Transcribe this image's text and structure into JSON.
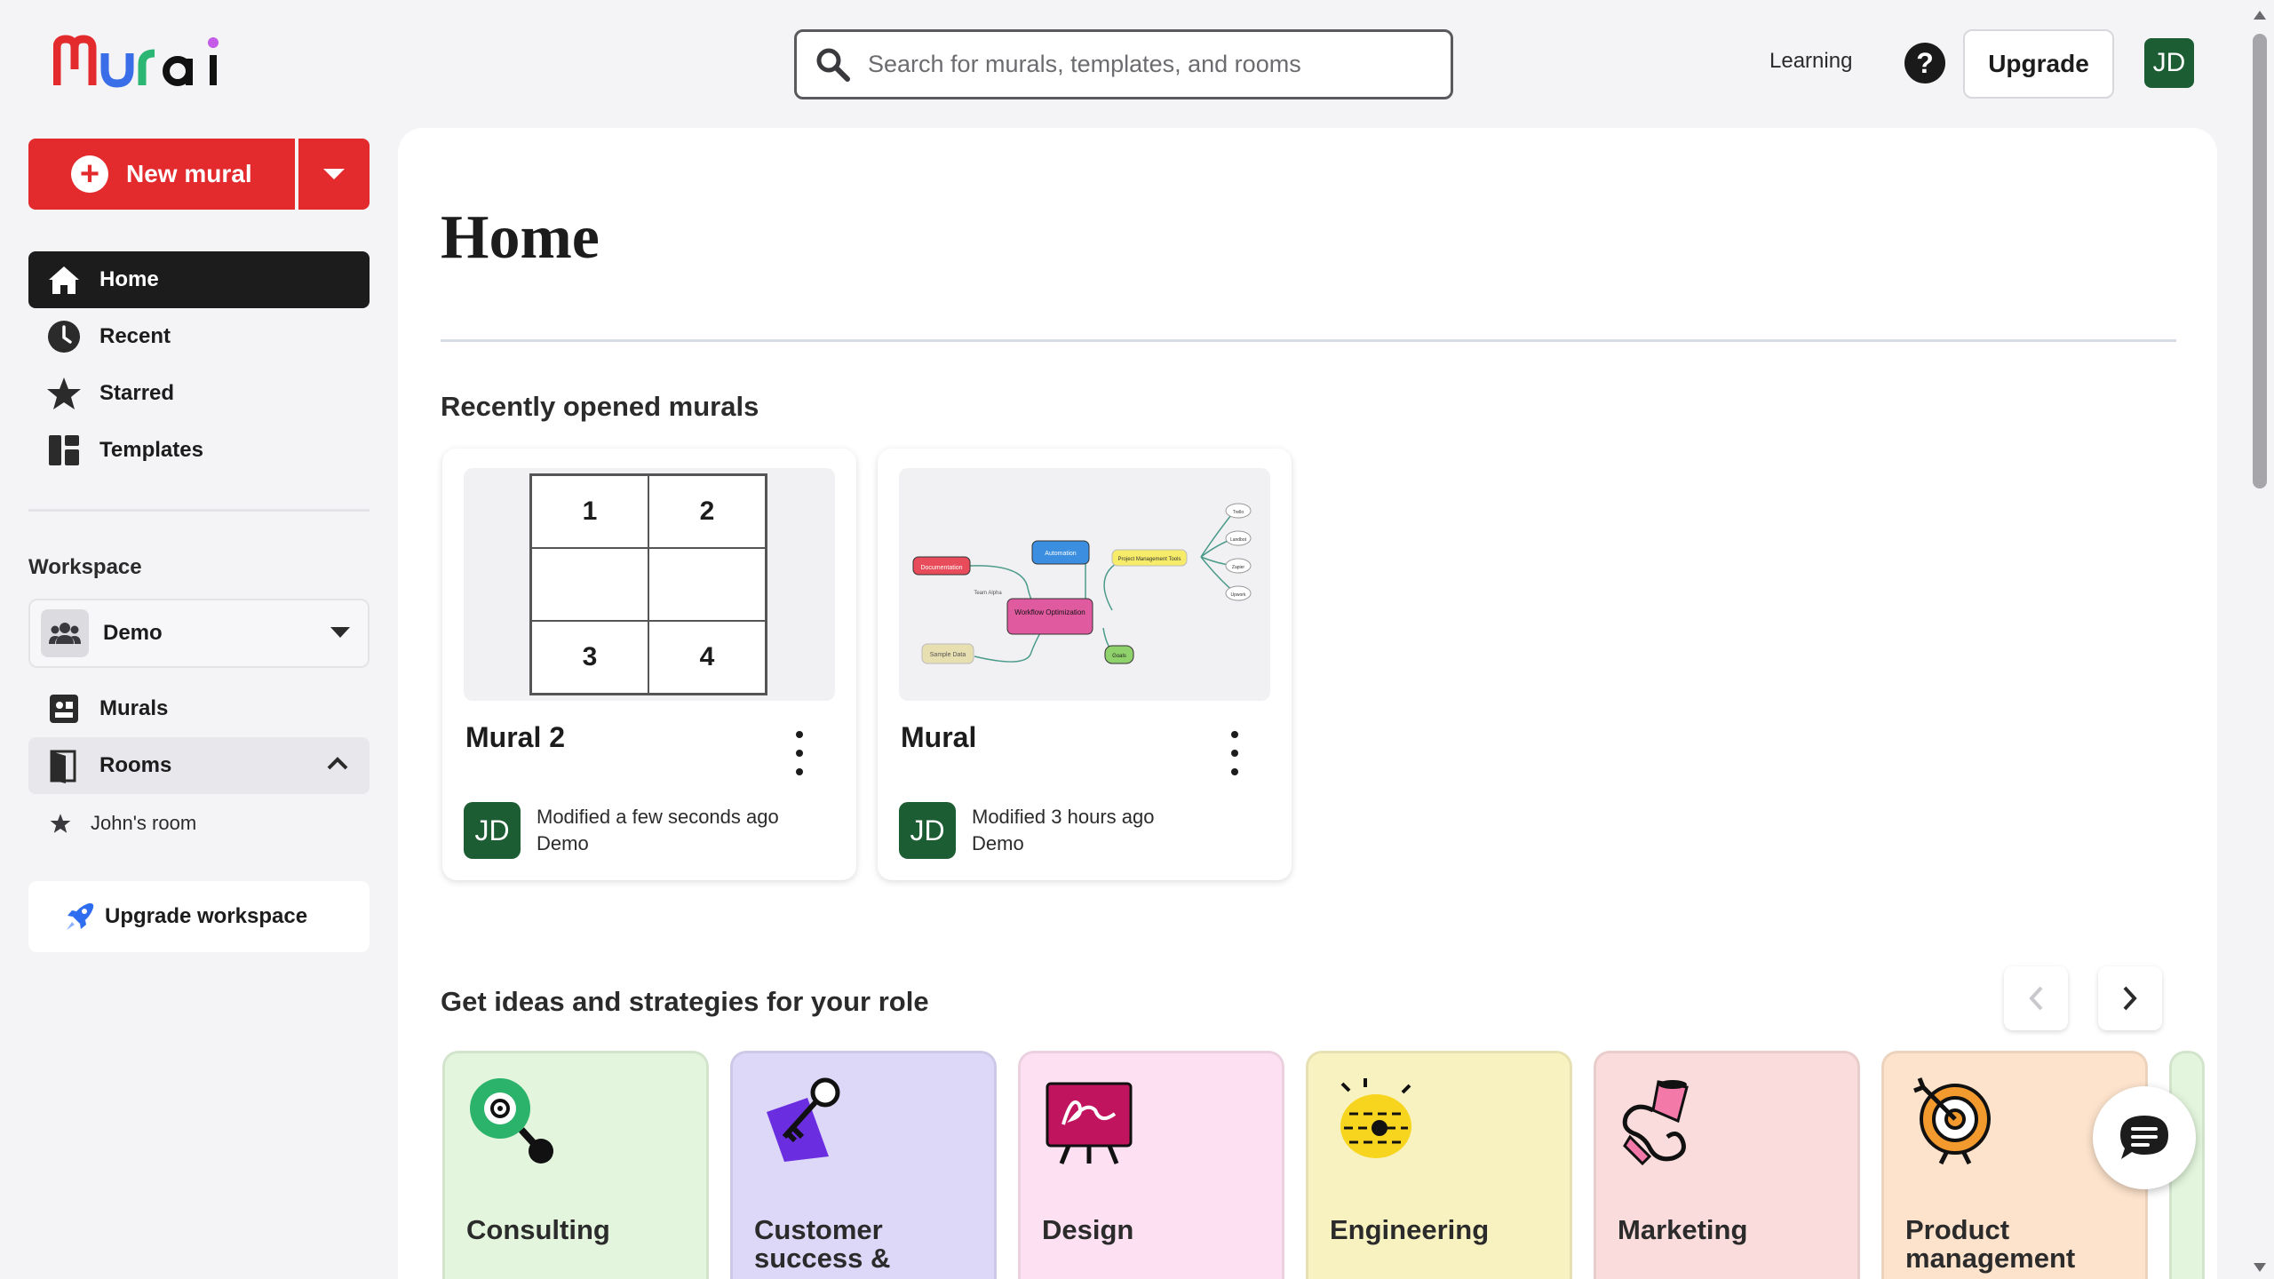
{
  "header": {
    "logo_text": "Mural",
    "search_placeholder": "Search for murals, templates, and rooms",
    "learning_label": "Learning",
    "help_label": "?",
    "upgrade_label": "Upgrade",
    "user_initials": "JD"
  },
  "sidebar": {
    "new_mural_label": "New mural",
    "nav": [
      {
        "label": "Home",
        "icon": "home-icon",
        "active": true
      },
      {
        "label": "Recent",
        "icon": "clock-icon"
      },
      {
        "label": "Starred",
        "icon": "star-icon"
      },
      {
        "label": "Templates",
        "icon": "templates-icon"
      }
    ],
    "workspace_label": "Workspace",
    "workspace_name": "Demo",
    "workspace_nav": [
      {
        "label": "Murals",
        "icon": "murals-icon"
      },
      {
        "label": "Rooms",
        "icon": "rooms-icon",
        "expanded": true
      }
    ],
    "rooms": [
      {
        "label": "John's room",
        "icon": "star-icon"
      }
    ],
    "upgrade_workspace_label": "Upgrade workspace"
  },
  "main": {
    "title": "Home",
    "recent_title": "Recently opened murals",
    "murals": [
      {
        "title": "Mural 2",
        "modified": "Modified a few seconds ago",
        "workspace": "Demo",
        "initials": "JD",
        "thumb_cells": [
          "1",
          "2",
          "",
          "",
          "3",
          "4"
        ]
      },
      {
        "title": "Mural",
        "modified": "Modified 3 hours ago",
        "workspace": "Demo",
        "initials": "JD",
        "thumb_nodes": {
          "center": "Workflow Optimization",
          "a": "Automation",
          "b": "Project Management Tools",
          "c": "Documentation",
          "d": "Sample Data",
          "e": "Goals",
          "f": "Team Alpha",
          "g": "Trello",
          "h": "Landbot",
          "i": "Zapier",
          "j": "Upwork"
        }
      }
    ],
    "ideas_title": "Get ideas and strategies for your role",
    "roles": [
      {
        "label": "Consulting",
        "color": "#e3f6dd"
      },
      {
        "label": "Customer success &",
        "color": "#ddd8f8"
      },
      {
        "label": "Design",
        "color": "#fde0f2"
      },
      {
        "label": "Engineering",
        "color": "#f8f2c0"
      },
      {
        "label": "Marketing",
        "color": "#fbdcdc"
      },
      {
        "label": "Product management",
        "color": "#fde3cc"
      }
    ]
  },
  "colors": {
    "brand_red": "#e32b2e",
    "avatar_green": "#1d5d33",
    "nav_active": "#1c1c1c"
  }
}
